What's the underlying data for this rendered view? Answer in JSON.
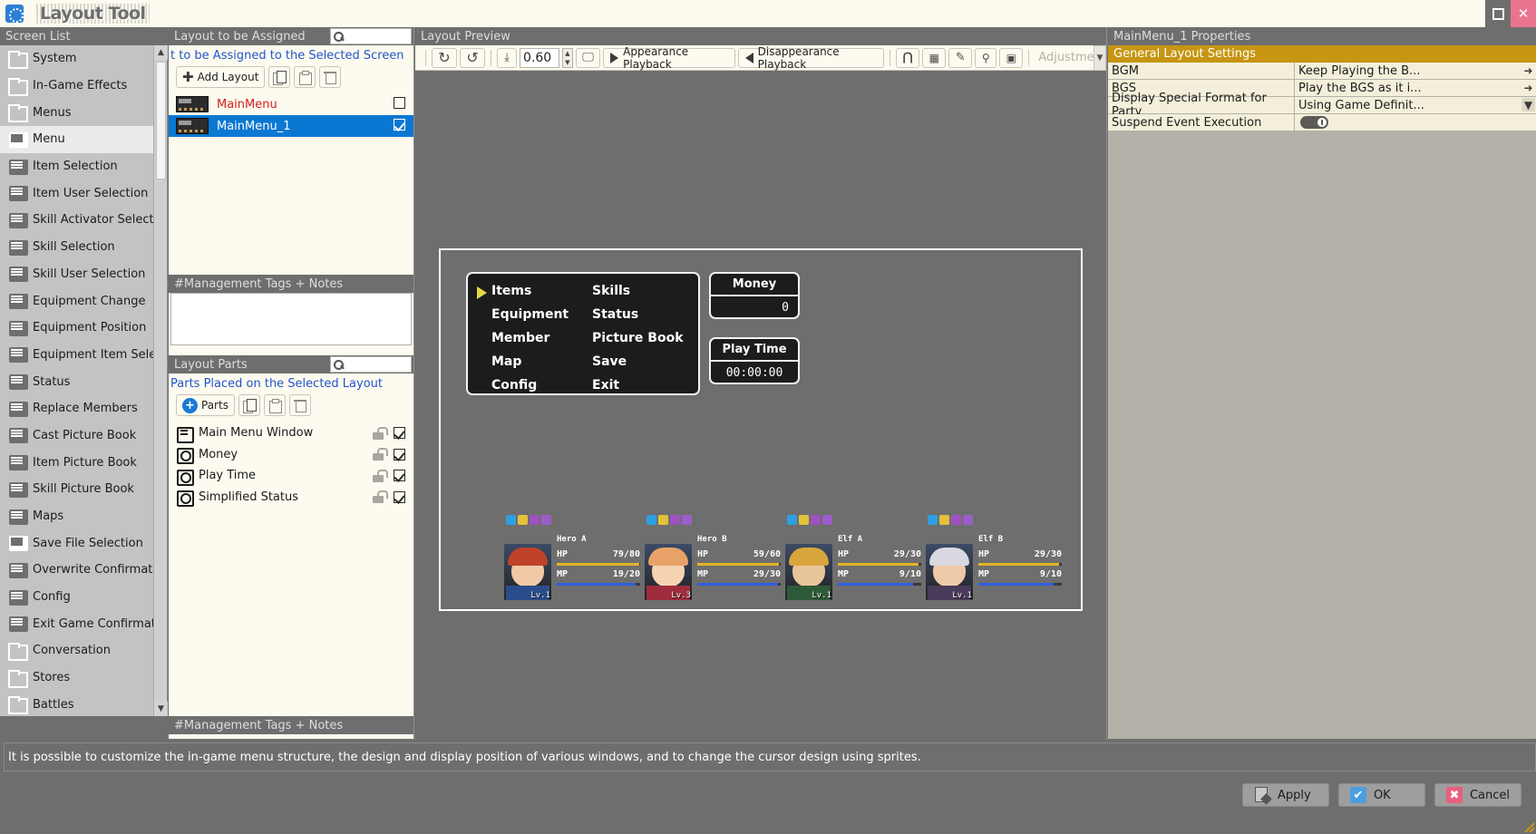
{
  "window": {
    "title": "Layout Tool",
    "app_icon": "cog-icon",
    "minimize_label": "□",
    "close_label": "✕"
  },
  "sidebar": {
    "header": "Screen List",
    "items": [
      {
        "label": "System",
        "icon": "folder-icon",
        "type": "folder",
        "selected": false
      },
      {
        "label": "In-Game Effects",
        "icon": "folder-icon",
        "type": "folder",
        "selected": false
      },
      {
        "label": "Menus",
        "icon": "folder-icon",
        "type": "folder",
        "selected": false
      },
      {
        "label": "Menu",
        "icon": "screen-icon",
        "type": "screen",
        "selected": true
      },
      {
        "label": "Item Selection",
        "icon": "screen-icon",
        "type": "screen",
        "selected": false
      },
      {
        "label": "Item User Selection",
        "icon": "screen-icon",
        "type": "screen",
        "selected": false
      },
      {
        "label": "Skill Activator Selection",
        "icon": "screen-icon",
        "type": "screen",
        "selected": false
      },
      {
        "label": "Skill Selection",
        "icon": "screen-icon",
        "type": "screen",
        "selected": false
      },
      {
        "label": "Skill User Selection",
        "icon": "screen-icon",
        "type": "screen",
        "selected": false
      },
      {
        "label": "Equipment Change",
        "icon": "screen-icon",
        "type": "screen",
        "selected": false
      },
      {
        "label": "Equipment Position",
        "icon": "screen-icon",
        "type": "screen",
        "selected": false
      },
      {
        "label": "Equipment Item Selection",
        "icon": "screen-icon",
        "type": "screen",
        "selected": false
      },
      {
        "label": "Status",
        "icon": "screen-icon",
        "type": "screen",
        "selected": false
      },
      {
        "label": "Replace Members",
        "icon": "screen-icon",
        "type": "screen",
        "selected": false
      },
      {
        "label": "Cast Picture Book",
        "icon": "screen-icon",
        "type": "screen",
        "selected": false
      },
      {
        "label": "Item Picture Book",
        "icon": "screen-icon",
        "type": "screen",
        "selected": false
      },
      {
        "label": "Skill Picture Book",
        "icon": "screen-icon",
        "type": "screen",
        "selected": false
      },
      {
        "label": "Maps",
        "icon": "screen-icon",
        "type": "screen",
        "selected": false
      },
      {
        "label": "Save File Selection",
        "icon": "screen-icon",
        "type": "screen",
        "selected": false
      },
      {
        "label": "Overwrite Confirmation",
        "icon": "screen-icon",
        "type": "screen",
        "selected": false
      },
      {
        "label": "Config",
        "icon": "screen-icon",
        "type": "screen",
        "selected": false
      },
      {
        "label": "Exit Game Confirmation",
        "icon": "screen-icon",
        "type": "screen",
        "selected": false
      },
      {
        "label": "Conversation",
        "icon": "folder-icon",
        "type": "folder",
        "selected": false
      },
      {
        "label": "Stores",
        "icon": "folder-icon",
        "type": "folder",
        "selected": false
      },
      {
        "label": "Battles",
        "icon": "folder-icon",
        "type": "folder",
        "selected": false
      }
    ]
  },
  "assign_panel": {
    "header": "Layout to be Assigned",
    "search_placeholder": "",
    "subtitle": "t to be Assigned to the Selected Screen",
    "add_button": "Add Layout",
    "copy_icon": "copy-icon",
    "paste_icon": "paste-icon",
    "delete_icon": "trash-icon",
    "layouts": [
      {
        "name": "MainMenu",
        "selected": false,
        "checked": false
      },
      {
        "name": "MainMenu_1",
        "selected": true,
        "checked": true
      }
    ],
    "notes_header": "#Management Tags + Notes",
    "notes_value": ""
  },
  "parts_panel": {
    "header": "Layout Parts",
    "search_placeholder": "",
    "subtitle": "Parts Placed on the Selected Layout",
    "add_button": "Parts",
    "copy_icon": "copy-icon",
    "paste_icon": "paste-icon",
    "delete_icon": "trash-icon",
    "parts": [
      {
        "name": "Main Menu Window",
        "icon": "window-part-icon",
        "locked": false,
        "visible": true
      },
      {
        "name": "Money",
        "icon": "object-part-icon",
        "locked": false,
        "visible": true
      },
      {
        "name": "Play Time",
        "icon": "object-part-icon",
        "locked": false,
        "visible": true
      },
      {
        "name": "Simplified Status",
        "icon": "object-part-icon",
        "locked": false,
        "visible": true
      }
    ],
    "notes_header": "#Management Tags + Notes"
  },
  "preview": {
    "header": "Layout Preview",
    "toolbar": {
      "rotate_cw_icon": "rotate-cw-icon",
      "rotate_ccw_icon": "rotate-ccw-icon",
      "fit_icon": "fit-to-screen-icon",
      "zoom_value": "0.60",
      "screen_icon": "monitor-icon",
      "appearance_label": "Appearance Playback",
      "disappearance_label": "Disappearance Playback",
      "magnet_icon": "magnet-icon",
      "grid_icon": "grid-icon",
      "pen_icon": "pen-icon",
      "pin_icon": "pin-icon",
      "layout_icon": "layout-icon",
      "adjustment_label": "Adjustment"
    },
    "game": {
      "menu_items": [
        "Items",
        "Skills",
        "Equipment",
        "Status",
        "Member",
        "Picture Book",
        "Map",
        "Save",
        "Config",
        "Exit"
      ],
      "cursor_icon": "cursor-arrow-icon",
      "money_title": "Money",
      "money_value": "0",
      "playtime_title": "Play Time",
      "playtime_value": "00:00:00",
      "party": [
        {
          "name": "Hero A",
          "level": "Lv.1",
          "hp_label": "HP",
          "hp_value": "79/80",
          "hp_pct": 99,
          "mp_label": "MP",
          "mp_value": "19/20",
          "mp_pct": 95,
          "hair": "#c1422a",
          "skin": "#f1c9a6",
          "cloth": "#2b4c8c"
        },
        {
          "name": "Hero B",
          "level": "Lv.3",
          "hp_label": "HP",
          "hp_value": "59/60",
          "hp_pct": 98,
          "mp_label": "MP",
          "mp_value": "29/30",
          "mp_pct": 97,
          "hair": "#e8a268",
          "skin": "#f6d3b2",
          "cloth": "#9e2c3c"
        },
        {
          "name": "Elf A",
          "level": "Lv.1",
          "hp_label": "HP",
          "hp_value": "29/30",
          "hp_pct": 97,
          "mp_label": "MP",
          "mp_value": "9/10",
          "mp_pct": 90,
          "hair": "#d9a63e",
          "skin": "#e9c59c",
          "cloth": "#2f5a3a"
        },
        {
          "name": "Elf B",
          "level": "Lv.1",
          "hp_label": "HP",
          "hp_value": "29/30",
          "hp_pct": 97,
          "mp_label": "MP",
          "mp_value": "9/10",
          "mp_pct": 90,
          "hair": "#d8d8e0",
          "skin": "#eec9a8",
          "cloth": "#4a3b5a"
        }
      ]
    }
  },
  "properties": {
    "header": "MainMenu_1 Properties",
    "group": "General Layout Settings",
    "rows": [
      {
        "key": "BGM",
        "value": "Keep Playing the B...",
        "control": "arrow"
      },
      {
        "key": "BGS",
        "value": "Play the BGS as it i...",
        "control": "arrow"
      },
      {
        "key": "Display Special Format for Party",
        "value": "Using Game Definit...",
        "control": "dropdown"
      },
      {
        "key": "Suspend Event Execution",
        "value": "",
        "control": "toggle"
      }
    ]
  },
  "statusbar": {
    "message": "It is possible to customize the in-game menu structure, the design and display position of various windows, and to change the cursor design using sprites."
  },
  "footer": {
    "apply": "Apply",
    "ok": "OK",
    "cancel": "Cancel",
    "ok_icon": "check-icon",
    "cancel_icon": "x-icon",
    "apply_icon": "apply-icon"
  },
  "colors": {
    "accent_blue": "#0a78d2",
    "gold": "#c79512",
    "red": "#d42020",
    "panel_cream": "#fdfaef",
    "gray": "#6e6e6e"
  }
}
